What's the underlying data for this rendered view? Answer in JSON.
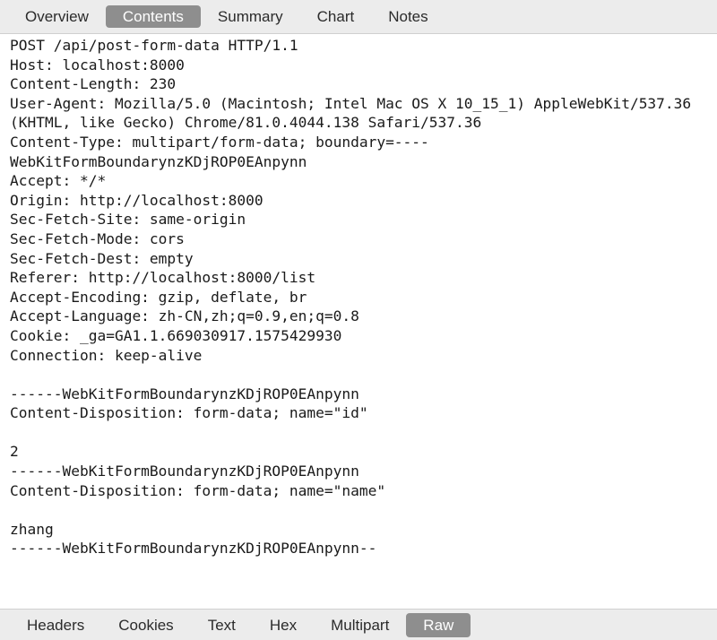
{
  "top_tabs": [
    {
      "label": "Overview",
      "active": false
    },
    {
      "label": "Contents",
      "active": true
    },
    {
      "label": "Summary",
      "active": false
    },
    {
      "label": "Chart",
      "active": false
    },
    {
      "label": "Notes",
      "active": false
    }
  ],
  "content": {
    "lines": [
      "POST /api/post-form-data HTTP/1.1",
      "Host: localhost:8000",
      "Content-Length: 230",
      "User-Agent: Mozilla/5.0 (Macintosh; Intel Mac OS X 10_15_1) AppleWebKit/537.36 (KHTML, like Gecko) Chrome/81.0.4044.138 Safari/537.36",
      "Content-Type: multipart/form-data; boundary=----WebKitFormBoundarynzKDjROP0EAnpynn",
      "Accept: */*",
      "Origin: http://localhost:8000",
      "Sec-Fetch-Site: same-origin",
      "Sec-Fetch-Mode: cors",
      "Sec-Fetch-Dest: empty",
      "Referer: http://localhost:8000/list",
      "Accept-Encoding: gzip, deflate, br",
      "Accept-Language: zh-CN,zh;q=0.9,en;q=0.8",
      "Cookie: _ga=GA1.1.669030917.1575429930",
      "Connection: keep-alive",
      "",
      "------WebKitFormBoundarynzKDjROP0EAnpynn",
      "Content-Disposition: form-data; name=\"id\"",
      "",
      "2",
      "------WebKitFormBoundarynzKDjROP0EAnpynn",
      "Content-Disposition: form-data; name=\"name\"",
      "",
      "zhang",
      "------WebKitFormBoundarynzKDjROP0EAnpynn--"
    ]
  },
  "bottom_tabs": [
    {
      "label": "Headers",
      "active": false
    },
    {
      "label": "Cookies",
      "active": false
    },
    {
      "label": "Text",
      "active": false
    },
    {
      "label": "Hex",
      "active": false
    },
    {
      "label": "Multipart",
      "active": false
    },
    {
      "label": "Raw",
      "active": true
    }
  ],
  "colors": {
    "active_tab_bg": "#8e8e8e",
    "bar_bg": "#ececec"
  }
}
